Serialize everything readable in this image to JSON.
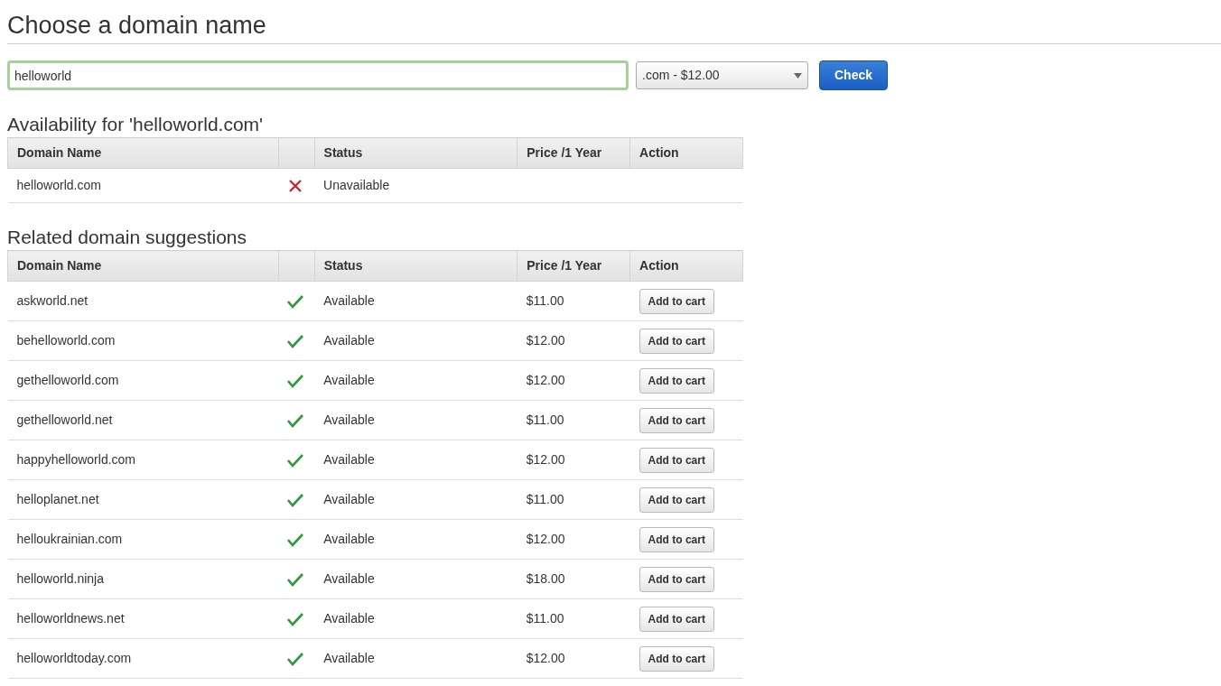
{
  "title": "Choose a domain name",
  "search": {
    "value": "helloworld",
    "tld": ".com - $12.00",
    "button": "Check"
  },
  "availability": {
    "heading": "Availability for 'helloworld.com'",
    "columns": [
      "Domain Name",
      "",
      "Status",
      "Price /1 Year",
      "Action"
    ],
    "rows": [
      {
        "domain": "helloworld.com",
        "available": false,
        "status": "Unavailable"
      }
    ]
  },
  "suggestions": {
    "heading": "Related domain suggestions",
    "columns": [
      "Domain Name",
      "",
      "Status",
      "Price /1 Year",
      "Action"
    ],
    "rows": [
      {
        "domain": "askworld.net",
        "available": true,
        "status": "Available",
        "price": "$11.00",
        "action": "Add to cart"
      },
      {
        "domain": "behelloworld.com",
        "available": true,
        "status": "Available",
        "price": "$12.00",
        "action": "Add to cart"
      },
      {
        "domain": "gethelloworld.com",
        "available": true,
        "status": "Available",
        "price": "$12.00",
        "action": "Add to cart"
      },
      {
        "domain": "gethelloworld.net",
        "available": true,
        "status": "Available",
        "price": "$11.00",
        "action": "Add to cart"
      },
      {
        "domain": "happyhelloworld.com",
        "available": true,
        "status": "Available",
        "price": "$12.00",
        "action": "Add to cart"
      },
      {
        "domain": "helloplanet.net",
        "available": true,
        "status": "Available",
        "price": "$11.00",
        "action": "Add to cart"
      },
      {
        "domain": "helloukrainian.com",
        "available": true,
        "status": "Available",
        "price": "$12.00",
        "action": "Add to cart"
      },
      {
        "domain": "helloworld.ninja",
        "available": true,
        "status": "Available",
        "price": "$18.00",
        "action": "Add to cart"
      },
      {
        "domain": "helloworldnews.net",
        "available": true,
        "status": "Available",
        "price": "$11.00",
        "action": "Add to cart"
      },
      {
        "domain": "helloworldtoday.com",
        "available": true,
        "status": "Available",
        "price": "$12.00",
        "action": "Add to cart"
      }
    ]
  }
}
